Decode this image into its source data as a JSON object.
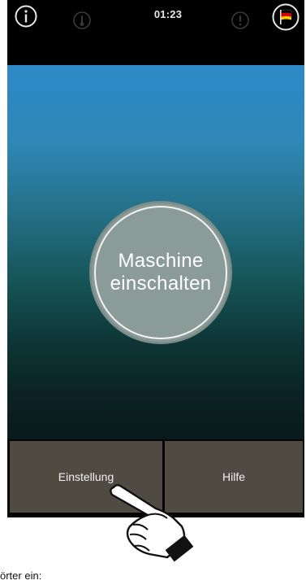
{
  "status_bar": {
    "time": "01:23",
    "icons": [
      "info-icon",
      "thermometer-icon",
      "warning-icon",
      "language-flag-icon"
    ]
  },
  "main": {
    "power_button_label": "Maschine\neinschalten"
  },
  "bottom_bar": {
    "settings_label": "Einstellung",
    "help_label": "Hilfe"
  },
  "caption": "örter ein:",
  "colors": {
    "gradient_top": "#2e88c6",
    "gradient_bottom": "#0a1a1c",
    "button_fill": "#8b9b98",
    "bottom_button": "#4f4b43",
    "flag_black": "#000000",
    "flag_red": "#dd0000",
    "flag_gold": "#ffcc00"
  }
}
